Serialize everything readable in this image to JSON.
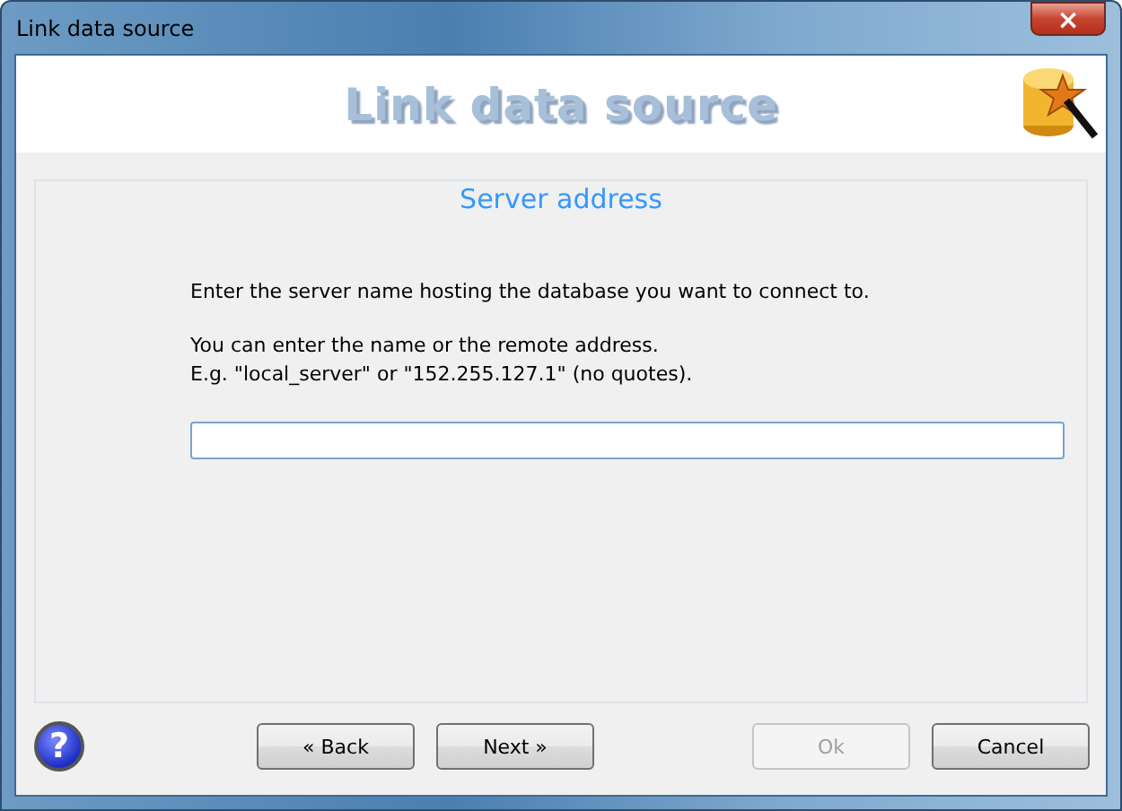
{
  "window": {
    "title": "Link data source",
    "close": "×"
  },
  "header": {
    "title": "Link data source"
  },
  "panel": {
    "heading": "Server address",
    "paragraphs": [
      [
        "Enter the server name hosting the database you want to connect to."
      ],
      [
        "You can enter the name or the remote address.",
        "E.g. \"local_server\" or \"152.255.127.1\" (no quotes)."
      ]
    ]
  },
  "footer": {
    "help": "?",
    "nav_buttons": [
      {
        "label": "« Back",
        "disabled": false
      },
      {
        "label": "Next »",
        "disabled": false
      }
    ],
    "action_buttons": [
      {
        "label": "Ok",
        "disabled": true
      },
      {
        "label": "Cancel",
        "disabled": false
      }
    ]
  }
}
